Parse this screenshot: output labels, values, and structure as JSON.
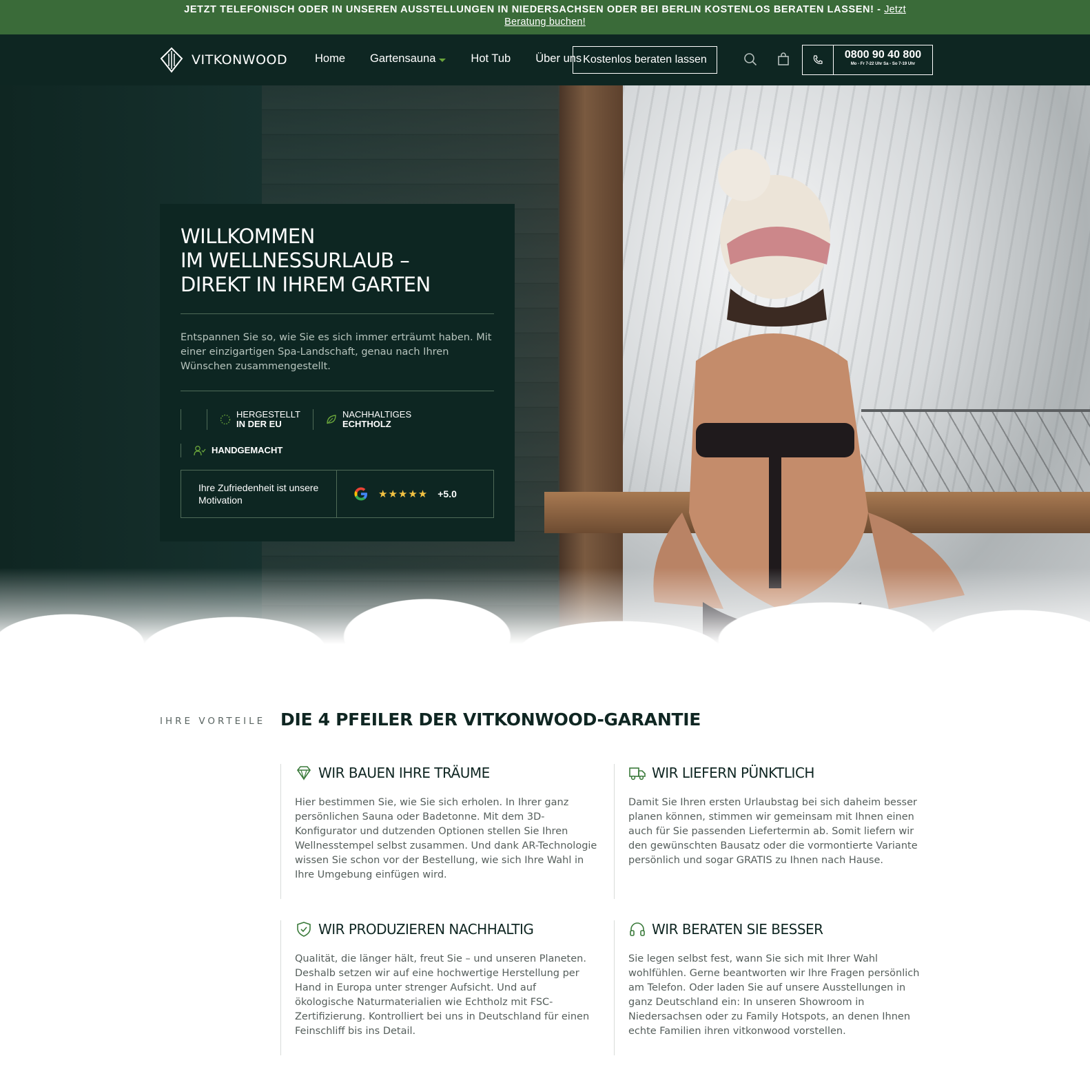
{
  "announcement": {
    "text": "JETZT TELEFONISCH ODER IN UNSEREN AUSSTELLUNGEN IN NIEDERSACHSEN ODER BEI BERLIN KOSTENLOS BERATEN LASSEN! - ",
    "link": "Jetzt Beratung buchen!"
  },
  "header": {
    "logo": "VITKONWOOD",
    "nav": [
      {
        "label": "Home"
      },
      {
        "label": "Gartensauna"
      },
      {
        "label": "Hot Tub"
      },
      {
        "label": "Über uns"
      }
    ],
    "cta": "Kostenlos beraten lassen",
    "phone": "0800 90 40 800",
    "hours": "Mo - Fr 7-22 Uhr Sa - So 7-19 Uhr",
    "icons": [
      "search-icon",
      "cart-icon",
      "phone-icon"
    ],
    "colors": {
      "bar": "#3a6b39",
      "header": "#0e2622",
      "accent": "#6aa53b"
    }
  },
  "hero": {
    "title_lines": [
      "WILLKOMMEN",
      "IM WELLNESSURLAUB –",
      "DIREKT IN IHREM GARTEN"
    ],
    "description": "Entspannen Sie so, wie Sie es sich immer erträumt haben. Mit einer einzigartigen Spa-Landschaft, genau nach Ihren Wünschen zusammengestellt.",
    "badges": [
      {
        "top": "HERGESTELLT",
        "bottom": "IN DER EU",
        "icon": "eu-stars-icon"
      },
      {
        "top": "NACHHALTIGES",
        "bottom": "ECHTHOLZ",
        "icon": "leaf-icon"
      },
      {
        "top": "",
        "bottom": "HANDGEMACHT",
        "icon": "user-check-icon"
      }
    ],
    "rating": {
      "text": "Ihre Zufriedenheit ist unsere Motivation",
      "stars": "★★★★★",
      "value": "+5.0"
    }
  },
  "benefits": {
    "eyebrow": "IHRE VORTEILE",
    "title": "DIE 4 PFEILER DER VITKONWOOD-GARANTIE",
    "items": [
      {
        "icon": "diamond-icon",
        "title": "WIR BAUEN IHRE TRÄUME",
        "text": "Hier bestimmen Sie, wie Sie sich erholen. In Ihrer ganz persönlichen Sauna oder Badetonne. Mit dem 3D-Konfigurator und dutzenden Optionen stellen Sie Ihren Wellnesstempel selbst zusammen. Und dank AR-Technologie wissen Sie schon vor der Bestellung, wie sich Ihre Wahl in Ihre Umgebung einfügen wird."
      },
      {
        "icon": "truck-icon",
        "title": "WIR LIEFERN PÜNKTLICH",
        "text": "Damit Sie Ihren ersten Urlaubstag bei sich daheim besser planen können, stimmen wir gemeinsam mit Ihnen einen auch für Sie passenden Liefertermin ab. Somit liefern wir den gewünschten Bausatz oder die vormontierte Variante persönlich und sogar GRATIS zu Ihnen nach Hause."
      },
      {
        "icon": "shield-check-icon",
        "title": "WIR PRODUZIEREN NACHHALTIG",
        "text": "Qualität, die länger hält, freut Sie – und unseren Planeten. Deshalb setzen wir auf eine hochwertige Herstellung per Hand in Europa unter strenger Aufsicht. Und auf ökologische Naturmaterialien wie Echtholz mit FSC-Zertifizierung. Kontrolliert bei uns in Deutschland für einen Feinschliff bis ins Detail."
      },
      {
        "icon": "headset-icon",
        "title": "WIR BERATEN SIE BESSER",
        "text": "Sie legen selbst fest, wann Sie sich mit Ihrer Wahl wohlfühlen. Gerne beantworten wir Ihre Fragen persönlich am Telefon. Oder laden Sie auf unsere Ausstellungen in ganz Deutschland ein: In unseren Showroom in Niedersachsen oder zu Family Hotspots, an denen Ihnen echte Familien ihren vitkonwood vorstellen."
      }
    ]
  }
}
